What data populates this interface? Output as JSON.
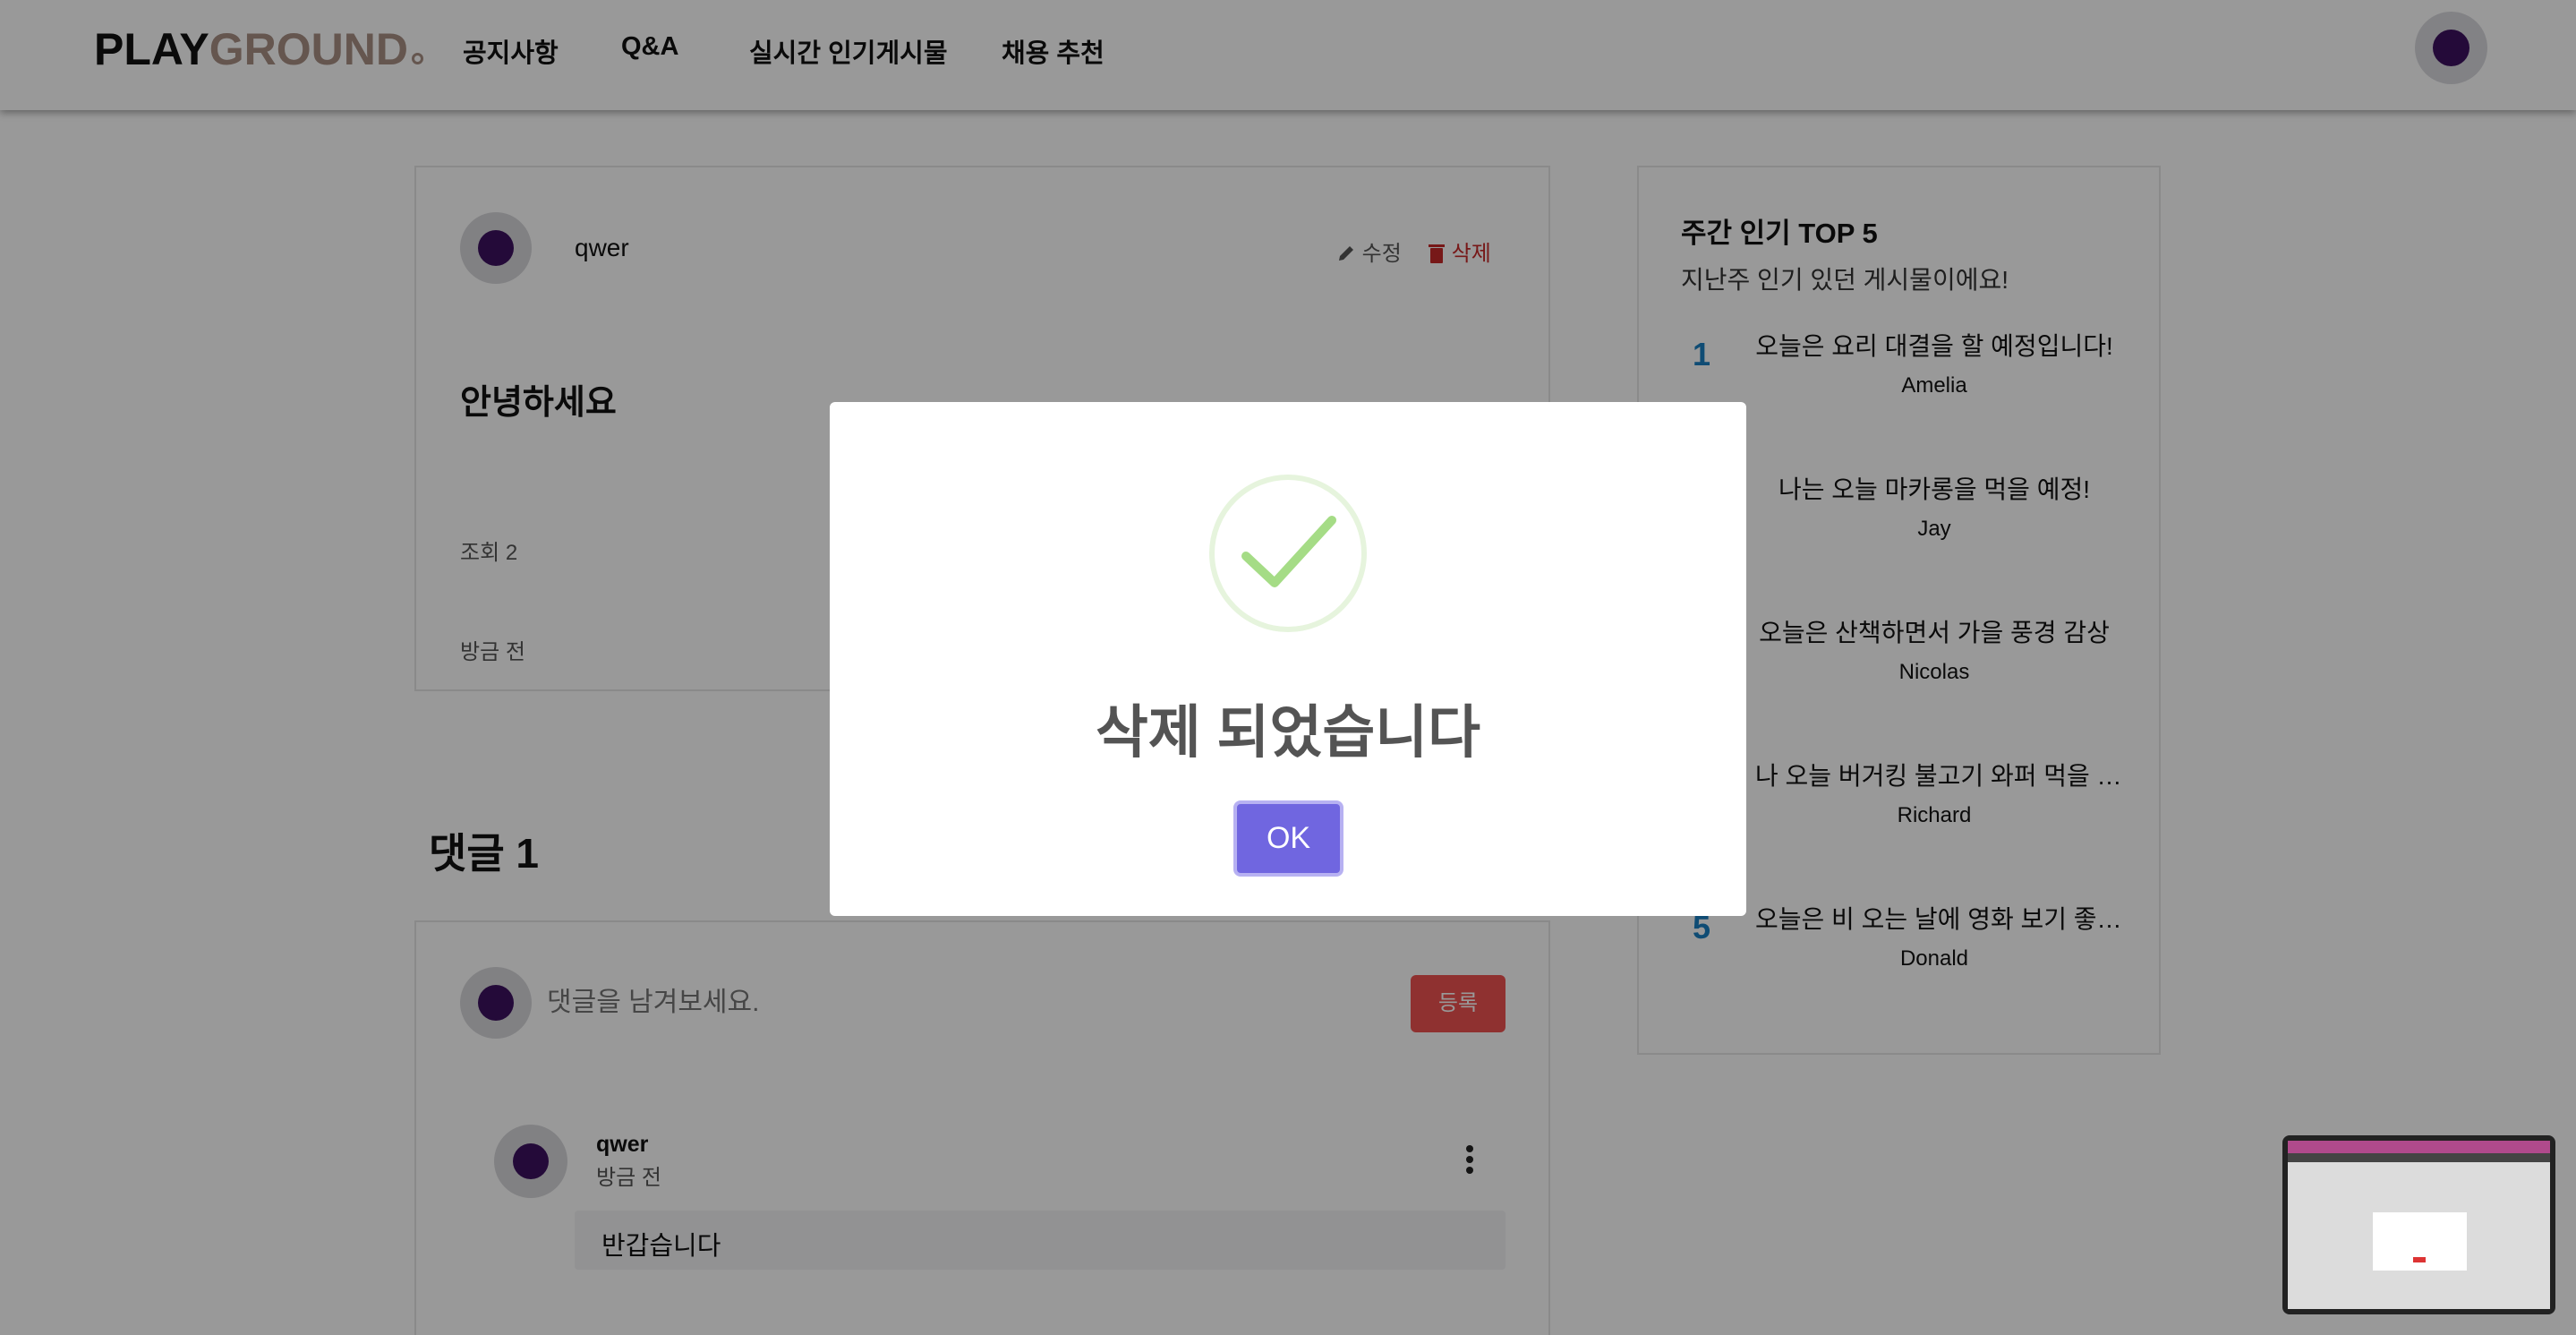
{
  "header": {
    "logo_part1": "PLAY",
    "logo_part2": "GROUND",
    "nav": [
      "공지사항",
      "Q&A",
      "실시간 인기게시물",
      "채용 추천"
    ]
  },
  "post": {
    "author": "qwer",
    "edit_label": "수정",
    "delete_label": "삭제",
    "title": "안녕하세요",
    "views": "조회 2",
    "time": "방금 전"
  },
  "comments": {
    "heading": "댓글 1",
    "input_placeholder": "댓글을 남겨보세요.",
    "submit_label": "등록",
    "items": [
      {
        "author": "qwer",
        "time": "방금 전",
        "text": "반갑습니다"
      }
    ]
  },
  "sidebar": {
    "title": "주간 인기 TOP 5",
    "subtitle": "지난주 인기 있던 게시물이에요!",
    "items": [
      {
        "rank": "1",
        "title": "오늘은 요리 대결을 할 예정입니다!",
        "author": "Amelia"
      },
      {
        "rank": "",
        "title": "나는 오늘 마카롱을 먹을 예정!",
        "author": "Jay"
      },
      {
        "rank": "",
        "title": "오늘은 산책하면서 가을 풍경 감상",
        "author": "Nicolas"
      },
      {
        "rank": "",
        "title": "나 오늘 버거킹 불고기 와퍼 먹을 …",
        "author": "Richard"
      },
      {
        "rank": "5",
        "title": "오늘은 비 오는 날에 영화 보기 좋…",
        "author": "Donald"
      }
    ]
  },
  "modal": {
    "message": "삭제 되었습니다",
    "ok_label": "OK"
  },
  "colors": {
    "accent": "#7066e0",
    "success": "#a5dc86",
    "danger": "#c62828",
    "rank": "#1a7fc1"
  }
}
